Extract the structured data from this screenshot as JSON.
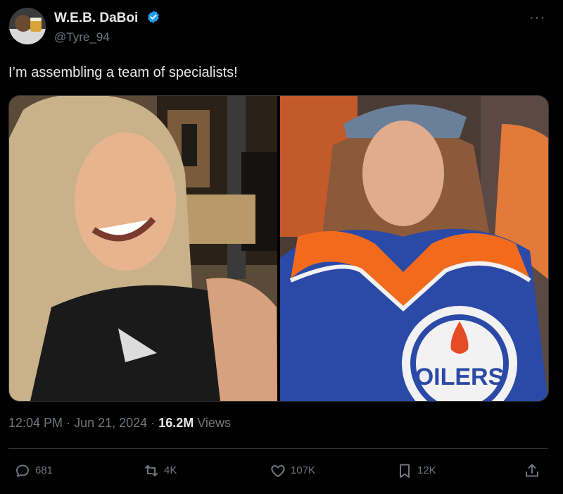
{
  "author": {
    "name": "W.E.B. DaBoi",
    "handle": "@Tyre_94",
    "verified": true
  },
  "more_menu": "···",
  "tweet": {
    "text": "I’m assembling a team of specialists!"
  },
  "media": {
    "jersey_text": "OILERS"
  },
  "meta": {
    "time": "12:04 PM",
    "date": "Jun 21, 2024",
    "views_count": "16.2M",
    "views_label": "Views",
    "sep": "·"
  },
  "actions": {
    "replies": "681",
    "reposts": "4K",
    "likes": "107K",
    "bookmarks": "12K"
  },
  "colors": {
    "background": "#000000",
    "text": "#e7e9ea",
    "secondary": "#71767b",
    "verified": "#1d9bf0",
    "divider": "#2f3336"
  }
}
